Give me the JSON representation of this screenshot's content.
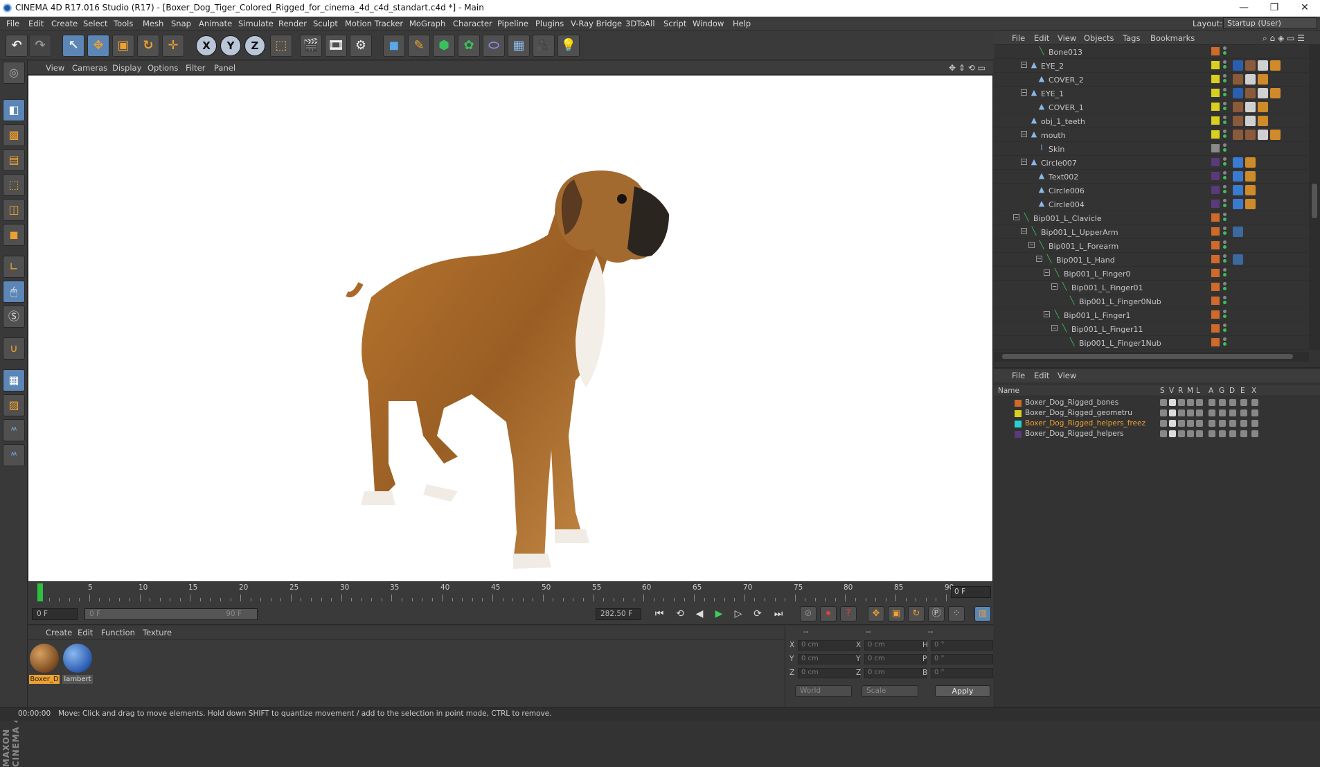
{
  "window": {
    "title": "CINEMA 4D R17.016 Studio (R17) - [Boxer_Dog_Tiger_Colored_Rigged_for_cinema_4d_c4d_standart.c4d *] - Main",
    "min": "—",
    "restore": "❐",
    "close": "✕"
  },
  "menu": [
    "File",
    "Edit",
    "Create",
    "Select",
    "Tools",
    "Mesh",
    "Snap",
    "Animate",
    "Simulate",
    "Render",
    "Sculpt",
    "Motion Tracker",
    "MoGraph",
    "Character",
    "Pipeline",
    "Plugins",
    "V-Ray Bridge",
    "3DToAll",
    "Script",
    "Window",
    "Help"
  ],
  "layout": {
    "label": "Layout:",
    "value": "Startup (User)"
  },
  "viewport": {
    "menu": [
      "View",
      "Cameras",
      "Display",
      "Options",
      "Filter",
      "Panel"
    ]
  },
  "timeline": {
    "ticks": [
      "0",
      "5",
      "10",
      "15",
      "20",
      "25",
      "30",
      "35",
      "40",
      "45",
      "50",
      "55",
      "60",
      "65",
      "70",
      "75",
      "80",
      "85",
      "90"
    ],
    "frame": "0 F"
  },
  "transport": {
    "start": "0 F",
    "range_start": "0 F",
    "range_end": "90 F",
    "fps": "282.50 F"
  },
  "materials": {
    "menu": [
      "Create",
      "Edit",
      "Function",
      "Texture"
    ],
    "items": [
      {
        "label": "Boxer_D",
        "selected": true
      },
      {
        "label": "lambert",
        "selected": false
      }
    ]
  },
  "coords": {
    "header": [
      "--",
      "--",
      "--"
    ],
    "rows": [
      {
        "a": "X",
        "v1": "0 cm",
        "b": "X",
        "v2": "0 cm",
        "c": "H",
        "v3": "0 °"
      },
      {
        "a": "Y",
        "v1": "0 cm",
        "b": "Y",
        "v2": "0 cm",
        "c": "P",
        "v3": "0 °"
      },
      {
        "a": "Z",
        "v1": "0 cm",
        "b": "Z",
        "v2": "0 cm",
        "c": "B",
        "v3": "0 °"
      }
    ],
    "world": "World",
    "scale": "Scale",
    "apply": "Apply"
  },
  "status": {
    "time": "00:00:00",
    "message": "Move: Click and drag to move elements. Hold down SHIFT to quantize movement / add to the selection in point mode, CTRL to remove."
  },
  "objects": {
    "menu": [
      "File",
      "Edit",
      "View",
      "Objects",
      "Tags",
      "Bookmarks"
    ],
    "rows": [
      {
        "name": "Bone013",
        "depth": 5,
        "type": "bone",
        "toggle": "",
        "color": "#d06a2a",
        "tags": []
      },
      {
        "name": "EYE_2",
        "depth": 4,
        "type": "null",
        "toggle": "−",
        "color": "#d8d020",
        "tags": [
          "#2a5fb0",
          "#8a5a3a",
          "#d0d0d0",
          "#d08a2a"
        ]
      },
      {
        "name": "COVER_2",
        "depth": 5,
        "type": "null",
        "toggle": "",
        "color": "#d8d020",
        "tags": [
          "#8a5a3a",
          "#d0d0d0",
          "#d08a2a"
        ]
      },
      {
        "name": "EYE_1",
        "depth": 4,
        "type": "null",
        "toggle": "−",
        "color": "#d8d020",
        "tags": [
          "#2a5fb0",
          "#8a5a3a",
          "#d0d0d0",
          "#d08a2a"
        ]
      },
      {
        "name": "COVER_1",
        "depth": 5,
        "type": "null",
        "toggle": "",
        "color": "#d8d020",
        "tags": [
          "#8a5a3a",
          "#d0d0d0",
          "#d08a2a"
        ]
      },
      {
        "name": "obj_1_teeth",
        "depth": 4,
        "type": "null",
        "toggle": "",
        "color": "#d8d020",
        "tags": [
          "#8a5a3a",
          "#d0d0d0",
          "#d08a2a"
        ]
      },
      {
        "name": "mouth",
        "depth": 4,
        "type": "null",
        "toggle": "−",
        "color": "#d8d020",
        "tags": [
          "#8a5a3a",
          "#8a5a3a",
          "#d0d0d0",
          "#d08a2a"
        ]
      },
      {
        "name": "Skin",
        "depth": 5,
        "type": "skin",
        "toggle": "",
        "color": "#8a8a8a",
        "tags": []
      },
      {
        "name": "Circle007",
        "depth": 4,
        "type": "null",
        "toggle": "−",
        "color": "#5a3a7a",
        "tags": [
          "#3a7ad0",
          "#d08a2a"
        ]
      },
      {
        "name": "Text002",
        "depth": 5,
        "type": "null",
        "toggle": "",
        "color": "#5a3a7a",
        "tags": [
          "#3a7ad0",
          "#d08a2a"
        ]
      },
      {
        "name": "Circle006",
        "depth": 5,
        "type": "null",
        "toggle": "",
        "color": "#5a3a7a",
        "tags": [
          "#3a7ad0",
          "#d08a2a"
        ]
      },
      {
        "name": "Circle004",
        "depth": 5,
        "type": "null",
        "toggle": "",
        "color": "#5a3a7a",
        "tags": [
          "#3a7ad0",
          "#d08a2a"
        ]
      },
      {
        "name": "Bip001_L_Clavicle",
        "depth": 3,
        "type": "bone",
        "toggle": "−",
        "color": "#d06a2a",
        "tags": []
      },
      {
        "name": "Bip001_L_UpperArm",
        "depth": 4,
        "type": "bone",
        "toggle": "−",
        "color": "#d06a2a",
        "tags": [
          "#3a6aa0"
        ]
      },
      {
        "name": "Bip001_L_Forearm",
        "depth": 5,
        "type": "bone",
        "toggle": "−",
        "color": "#d06a2a",
        "tags": []
      },
      {
        "name": "Bip001_L_Hand",
        "depth": 6,
        "type": "bone",
        "toggle": "−",
        "color": "#d06a2a",
        "tags": [
          "#3a6aa0"
        ]
      },
      {
        "name": "Bip001_L_Finger0",
        "depth": 7,
        "type": "bone",
        "toggle": "−",
        "color": "#d06a2a",
        "tags": []
      },
      {
        "name": "Bip001_L_Finger01",
        "depth": 8,
        "type": "bone",
        "toggle": "−",
        "color": "#d06a2a",
        "tags": []
      },
      {
        "name": "Bip001_L_Finger0Nub",
        "depth": 9,
        "type": "bone",
        "toggle": "",
        "color": "#d06a2a",
        "tags": []
      },
      {
        "name": "Bip001_L_Finger1",
        "depth": 7,
        "type": "bone",
        "toggle": "−",
        "color": "#d06a2a",
        "tags": []
      },
      {
        "name": "Bip001_L_Finger11",
        "depth": 8,
        "type": "bone",
        "toggle": "−",
        "color": "#d06a2a",
        "tags": []
      },
      {
        "name": "Bip001_L_Finger1Nub",
        "depth": 9,
        "type": "bone",
        "toggle": "",
        "color": "#d06a2a",
        "tags": []
      }
    ]
  },
  "layers": {
    "menu": [
      "File",
      "Edit",
      "View"
    ],
    "columns": [
      "Name",
      "S",
      "V",
      "R",
      "M",
      "L",
      "A",
      "G",
      "D",
      "E",
      "X"
    ],
    "rows": [
      {
        "name": "Boxer_Dog_Rigged_bones",
        "color": "#d06a2a",
        "highlight": false
      },
      {
        "name": "Boxer_Dog_Rigged_geometru",
        "color": "#d8d020",
        "highlight": false
      },
      {
        "name": "Boxer_Dog_Rigged_helpers_freez",
        "color": "#2ad0d0",
        "highlight": true
      },
      {
        "name": "Boxer_Dog_Rigged_helpers",
        "color": "#5a3a7a",
        "highlight": false
      }
    ]
  },
  "colors": {
    "accent": "#5b86b6",
    "highlight_text": "#f0a030"
  }
}
